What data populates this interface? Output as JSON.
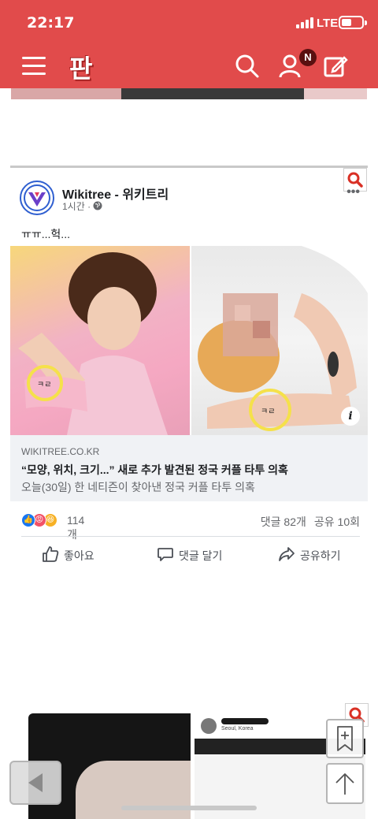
{
  "status_bar": {
    "time": "22:17",
    "network": "LTE"
  },
  "header": {
    "logo": "판",
    "notification_badge": "N"
  },
  "post": {
    "author": "Wikitree - 위키트리",
    "time_ago": "1시간 · ",
    "text": "ㅠㅠ...헉...",
    "link": {
      "domain": "WIKITREE.CO.KR",
      "title": "“모양, 위치, 크기...” 새로 추가 발견된 정국 커플 타투 의혹",
      "description": "오늘(30일) 한 네티즌이 찾아낸 정국 커플 타투 의혹"
    },
    "info_glyph": "i",
    "reaction_count": "114개",
    "comments": "댓글 82개",
    "shares": "공유 10회",
    "actions": {
      "like": "좋아요",
      "comment": "댓글 달기",
      "share": "공유하기"
    }
  },
  "lower_post": {
    "location": "Seoul, Korea"
  },
  "colors": {
    "header_red": "#e14b4b",
    "facebook_blue": "#1877f2",
    "link_bg": "#f0f2f5"
  }
}
